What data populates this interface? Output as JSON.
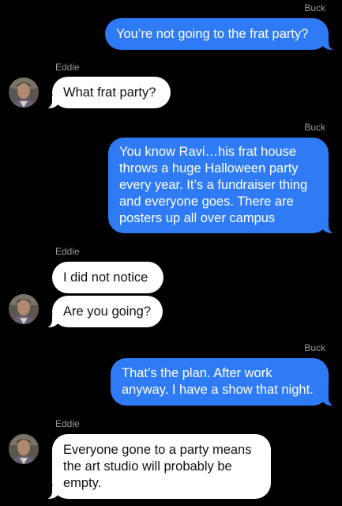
{
  "messages": [
    {
      "sender": "Buck",
      "text": "You’re not going to the frat party?"
    },
    {
      "sender": "Eddie",
      "text": "What frat party?"
    },
    {
      "sender": "Buck",
      "text": "You know Ravi…his frat house\nthrows a huge Halloween party\nevery year. It’s a fundraiser thing\nand everyone goes. There are\nposters up all over campus"
    },
    {
      "sender": "Eddie",
      "text": "I did not notice"
    },
    {
      "sender": "Eddie",
      "text": "Are you going?"
    },
    {
      "sender": "Buck",
      "text": "That’s the plan. After work\nanyway. I have a show that night."
    },
    {
      "sender": "Eddie",
      "text": "Everyone gone to a party means\nthe art studio will probably be\nempty."
    }
  ],
  "colors": {
    "background": "#000000",
    "outgoing_bubble": "#2f7bf6",
    "incoming_bubble": "#ffffff",
    "sender_label": "#9a9a9f"
  },
  "icons": {
    "avatar": "contact-photo-eddie"
  }
}
